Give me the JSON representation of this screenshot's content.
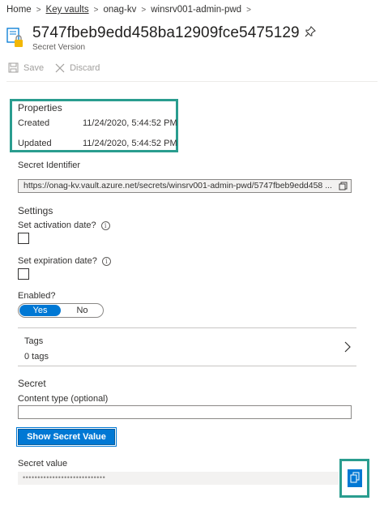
{
  "breadcrumb": {
    "items": [
      "Home",
      "Key vaults",
      "onag-kv",
      "winsrv001-admin-pwd"
    ],
    "separator": ">"
  },
  "header": {
    "title": "5747fbeb9edd458ba12909fce5475129",
    "subtitle": "Secret Version"
  },
  "toolbar": {
    "save_label": "Save",
    "discard_label": "Discard"
  },
  "properties": {
    "title": "Properties",
    "created_label": "Created",
    "created_value": "11/24/2020, 5:44:52 PM",
    "updated_label": "Updated",
    "updated_value": "11/24/2020, 5:44:52 PM"
  },
  "identifier": {
    "label": "Secret Identifier",
    "value": "https://onag-kv.vault.azure.net/secrets/winsrv001-admin-pwd/5747fbeb9edd458 ..."
  },
  "settings": {
    "title": "Settings",
    "activation_label": "Set activation date?",
    "expiration_label": "Set expiration date?",
    "enabled_label": "Enabled?",
    "enabled_yes": "Yes",
    "enabled_no": "No",
    "enabled_value": "Yes"
  },
  "tags": {
    "title": "Tags",
    "count": "0 tags"
  },
  "secret": {
    "title": "Secret",
    "content_type_label": "Content type (optional)",
    "content_type_value": "",
    "show_button": "Show Secret Value",
    "value_label": "Secret value",
    "masked_value": "••••••••••••••••••••••••••••"
  },
  "colors": {
    "accent": "#0078d4",
    "highlight": "#2a9d8f"
  }
}
